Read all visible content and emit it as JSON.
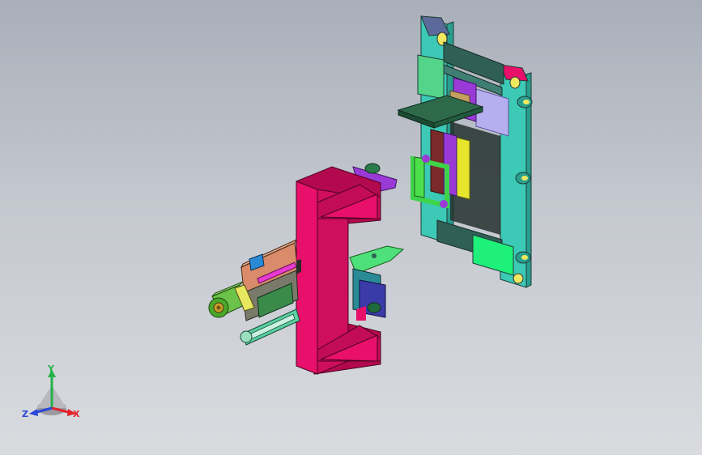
{
  "viewport": {
    "background_top": "#a9afb9",
    "background_bottom": "#d9dbdf"
  },
  "colors": {
    "frame_teal": "#3cc9b6",
    "frame_dark": "#2f5f55",
    "pink_column": "#e8106a",
    "pink_dark": "#b3094f",
    "violet": "#9a3ad6",
    "green_plate": "#4ee07a",
    "lavender_plate": "#b7aef0",
    "yellow": "#e6e62d",
    "motor_green": "#6cc34a",
    "gear_salmon": "#d98b6a"
  },
  "triad": {
    "x_label": "X",
    "y_label": "Y",
    "z_label": "Z",
    "x_color": "#e0222a",
    "y_color": "#22b34a",
    "z_color": "#2a46d6"
  },
  "icons": {
    "triad": "reference-triad-icon"
  }
}
